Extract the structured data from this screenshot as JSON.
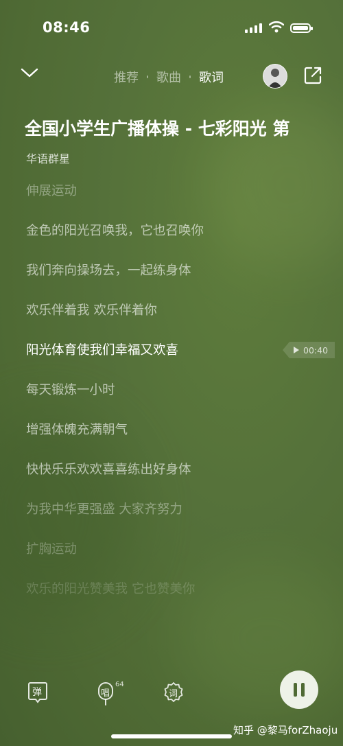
{
  "status": {
    "time": "08:46"
  },
  "nav": {
    "tabs": [
      {
        "label": "推荐",
        "active": false
      },
      {
        "label": "歌曲",
        "active": false
      },
      {
        "label": "歌词",
        "active": true
      }
    ]
  },
  "song": {
    "title": "全国小学生广播体操 - 七彩阳光 第",
    "artist": "华语群星"
  },
  "lyrics": [
    {
      "text": "伸展运动",
      "state": "dim1"
    },
    {
      "text": "金色的阳光召唤我，它也召唤你",
      "state": "normal"
    },
    {
      "text": "我们奔向操场去，一起练身体",
      "state": "normal"
    },
    {
      "text": "欢乐伴着我 欢乐伴着你",
      "state": "normal"
    },
    {
      "text": "阳光体育使我们幸福又欢喜",
      "state": "current"
    },
    {
      "text": "每天锻炼一小时",
      "state": "normal"
    },
    {
      "text": "增强体魄充满朝气",
      "state": "normal"
    },
    {
      "text": "快快乐乐欢欢喜喜练出好身体",
      "state": "normal"
    },
    {
      "text": "为我中华更强盛 大家齐努力",
      "state": "dim1"
    },
    {
      "text": "扩胸运动",
      "state": "dim2"
    },
    {
      "text": "欢乐的阳光赞美我 它也赞美你",
      "state": "dim3"
    }
  ],
  "current_time": "00:40",
  "bottom": {
    "danmu_label": "弹",
    "sing_label": "唱",
    "sing_count": "64",
    "lyric_label": "词"
  },
  "watermark": "知乎 @黎马forZhaoju",
  "colors": {
    "background": "#55713a",
    "pause_button": "#eef2e8"
  }
}
